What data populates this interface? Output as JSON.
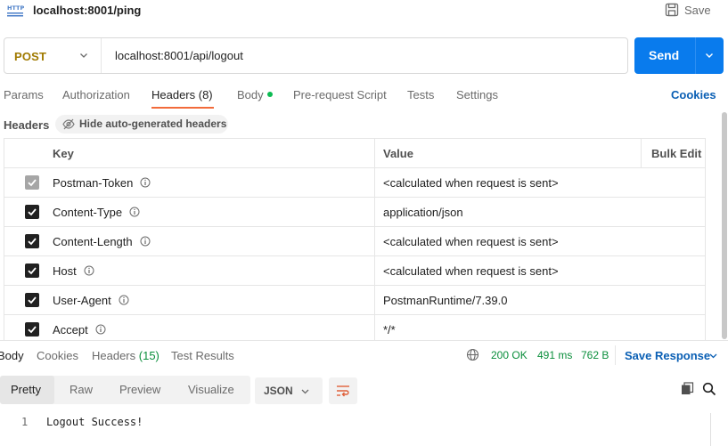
{
  "header": {
    "request_name": "localhost:8001/ping",
    "save_label": "Save",
    "icon": "http-icon"
  },
  "url_bar": {
    "method": "POST",
    "url": "localhost:8001/api/logout",
    "send_label": "Send"
  },
  "request_tabs": [
    {
      "label": "Params"
    },
    {
      "label": "Authorization"
    },
    {
      "label": "Headers (8)"
    },
    {
      "label": "Body"
    },
    {
      "label": "Pre-request Script"
    },
    {
      "label": "Tests"
    },
    {
      "label": "Settings"
    }
  ],
  "active_request_tab": "Headers (8)",
  "cookies_label": "Cookies",
  "headers_section": {
    "label": "Headers",
    "hide_auto_label": "Hide auto-generated headers"
  },
  "table": {
    "col_key": "Key",
    "col_value": "Value",
    "bulk_edit": "Bulk Edit",
    "rows": [
      {
        "key": "Postman-Token",
        "value": "<calculated when request is sent>",
        "checked": true,
        "disabled": true
      },
      {
        "key": "Content-Type",
        "value": "application/json",
        "checked": true,
        "disabled": false
      },
      {
        "key": "Content-Length",
        "value": "<calculated when request is sent>",
        "checked": true,
        "disabled": false
      },
      {
        "key": "Host",
        "value": "<calculated when request is sent>",
        "checked": true,
        "disabled": false
      },
      {
        "key": "User-Agent",
        "value": "PostmanRuntime/7.39.0",
        "checked": true,
        "disabled": false
      },
      {
        "key": "Accept",
        "value": "*/*",
        "checked": true,
        "disabled": false
      }
    ]
  },
  "response": {
    "tabs": {
      "body": "Body",
      "cookies": "Cookies",
      "headers": "Headers",
      "headers_count": "(15)",
      "test_results": "Test Results"
    },
    "status": "200 OK",
    "time": "491 ms",
    "size": "762 B",
    "save_response": "Save Response",
    "views": {
      "pretty": "Pretty",
      "raw": "Raw",
      "preview": "Preview",
      "visualize": "Visualize"
    },
    "format": "JSON",
    "line_number": "1",
    "body_text": "Logout Success!"
  },
  "colors": {
    "accent_orange": "#f26b3a",
    "send_blue": "#097bed",
    "link_blue": "#0a5fb4",
    "status_green": "#0a8e3b",
    "method_post": "#a07a00"
  }
}
